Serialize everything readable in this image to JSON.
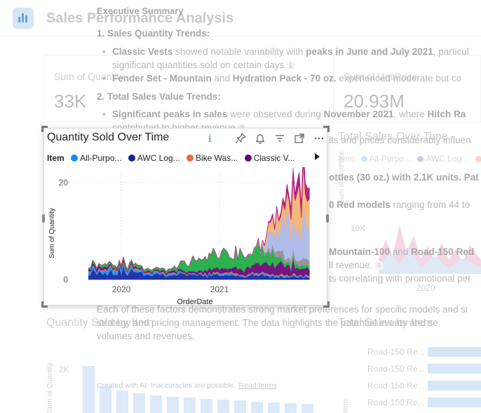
{
  "report": {
    "title": "Sales Performance Analysis",
    "cards": [
      {
        "label": "Sum of Quantity",
        "value": "33K"
      },
      {
        "label": "Sum of UnitPrice",
        "value": "20.93M"
      }
    ],
    "sections": {
      "total_sales_over_time": "Total Sales Over Time",
      "quantity_sold_by_item": "Quantity Sold by Item",
      "total_sales_by_item": "Total Sales by Item"
    },
    "bg_legend": {
      "label": "Item",
      "items": [
        "All-Purpo...",
        "AWC Log..."
      ]
    },
    "bg_axis": {
      "tick_10k": "10K",
      "tick_2020": "2020",
      "tick_2k": "2K",
      "ylabel_unitprice": "Sum of UnitPrice",
      "ylabel_quantity": "Sum of Quantity",
      "ylabel_item": "Item"
    },
    "hbar_labels": [
      "Road-150 Re...",
      "Road-150 Re...",
      "Road-150 Re...",
      "Road-150 Re..."
    ]
  },
  "summary": {
    "heading": "Executive Summary",
    "s1_title": "1. Sales Quantity Trends:",
    "s1_b1_bold1": "Classic Vests",
    "s1_b1_mid": " showed notable variability with ",
    "s1_b1_bold2": "peaks in June and July 2021",
    "s1_b1_end": ", particul",
    "s1_b1_cont": "significant quantities sold on certain days",
    "s1_b2_bold1": "Fender Set - Mountain",
    "s1_b2_mid": " and ",
    "s1_b2_bold2": "Hydration Pack - 70 oz.",
    "s1_b2_end": " experienced moderate but co",
    "s2_title": "2. Total Sales Value Trends:",
    "s2_b1_bold1": "Significant peaks in sales",
    "s2_b1_mid": " were observed during ",
    "s2_b1_bold2": "November 2021",
    "s2_b1_end": ", where ",
    "s2_b1_bold3": "Hitch Ra",
    "s2_b1_cont": "contributed to higher revenue",
    "r1_frag": "its and prices considerably influen",
    "r2_frag": "ottles (30 oz.) with 2.1K units. Pat",
    "r3_bold": "0 Red models",
    "r3_frag": " ranging from 44 to",
    "r4_bold1": "Mountain-100",
    "r4_mid": " and ",
    "r4_bold2": "Road-150 Red",
    "r5_frag": "ll revenue.",
    "r6_frag": "ts correlating with promotional per",
    "p1": "Each of these factors demonstrates strong market preferences for specific models and si",
    "p2": "strategy and pricing management. The data highlights the potential events and se",
    "p3": "volumes and revenues.",
    "cite1": "1",
    "cite2": "2",
    "cite5": "5",
    "footnote": "Created with AI. Inaccuracies are possible.",
    "footnote_link": "Read terms"
  },
  "visual": {
    "title": "Quantity Sold Over Time",
    "info_icon": "i",
    "legend_label": "Item",
    "icons": [
      "pin-icon",
      "bell-icon",
      "filter-icon",
      "focus-mode-icon",
      "more-options-icon"
    ]
  },
  "colors": {
    "all_purpose": "#118DFF",
    "awc_logo": "#12239E",
    "bike_wash": "#E66C37",
    "classic_vest": "#6B007B",
    "green": "#1AAB40",
    "orange_light": "#F5B26F",
    "lavender": "#A9B6E8",
    "gray": "#8E8E8E",
    "magenta": "#B0107A"
  },
  "chart_data": {
    "type": "area",
    "title": "Quantity Sold Over Time",
    "xlabel": "OrderDate",
    "ylabel": "Sum of Quantity",
    "x_ticks": [
      "2020",
      "2021"
    ],
    "y_ticks": [
      0,
      20
    ],
    "ylim": [
      0,
      22
    ],
    "grid": true,
    "stacked": true,
    "legend_title": "Item",
    "legend_position": "top",
    "legend_visible": [
      "All-Purpo...",
      "AWC Log...",
      "Bike Was...",
      "Classic V..."
    ],
    "x_range": [
      "2019-07",
      "2022-01"
    ],
    "series": [
      {
        "name": "AWC Log...",
        "color": "#12239E",
        "points": [
          [
            "2019-07",
            2
          ],
          [
            "2019-10",
            1.5
          ],
          [
            "2020-01",
            1.8
          ],
          [
            "2020-04",
            1.2
          ],
          [
            "2020-07",
            1.0
          ],
          [
            "2020-10",
            0.8
          ],
          [
            "2021-01",
            0.8
          ],
          [
            "2021-04",
            0.8
          ],
          [
            "2021-06",
            0.8
          ],
          [
            "2021-09",
            0.5
          ],
          [
            "2022-01",
            0.5
          ]
        ]
      },
      {
        "name": "All-Purpo...",
        "color": "#118DFF",
        "points": [
          [
            "2019-07",
            0.5
          ],
          [
            "2019-10",
            0.6
          ],
          [
            "2020-01",
            0.7
          ],
          [
            "2020-04",
            0.4
          ],
          [
            "2020-07",
            0.3
          ],
          [
            "2020-10",
            0.2
          ],
          [
            "2021-01",
            0.3
          ],
          [
            "2021-04",
            0.3
          ],
          [
            "2021-06",
            0.3
          ],
          [
            "2021-09",
            0.3
          ],
          [
            "2022-01",
            0.3
          ]
        ]
      },
      {
        "name": "Bike Was...",
        "color": "#E66C37",
        "points": [
          [
            "2019-07",
            0.2
          ],
          [
            "2019-10",
            0.2
          ],
          [
            "2020-01",
            0.3
          ],
          [
            "2020-04",
            0.2
          ],
          [
            "2020-07",
            0.2
          ],
          [
            "2020-10",
            0.1
          ],
          [
            "2021-01",
            0.2
          ],
          [
            "2021-04",
            0.2
          ],
          [
            "2021-06",
            0.2
          ],
          [
            "2021-09",
            0.2
          ],
          [
            "2022-01",
            0.2
          ]
        ]
      },
      {
        "name": "Classic V...",
        "color": "#6B007B",
        "points": [
          [
            "2019-07",
            0.3
          ],
          [
            "2019-10",
            0.4
          ],
          [
            "2020-01",
            0.3
          ],
          [
            "2020-04",
            0.2
          ],
          [
            "2020-07",
            0.3
          ],
          [
            "2020-10",
            0.3
          ],
          [
            "2021-01",
            0.8
          ],
          [
            "2021-04",
            1.0
          ],
          [
            "2021-06",
            1.6
          ],
          [
            "2021-09",
            2.0
          ],
          [
            "2022-01",
            2.0
          ]
        ]
      },
      {
        "color": "#1AAB40",
        "points": [
          [
            "2019-07",
            0.3
          ],
          [
            "2019-10",
            0.4
          ],
          [
            "2020-01",
            0.5
          ],
          [
            "2020-04",
            0.4
          ],
          [
            "2020-07",
            0.5
          ],
          [
            "2020-10",
            2.5
          ],
          [
            "2021-01",
            2.8
          ],
          [
            "2021-04",
            3.2
          ],
          [
            "2021-06",
            3.0
          ],
          [
            "2021-09",
            0.6
          ],
          [
            "2022-01",
            0.5
          ]
        ]
      },
      {
        "color": "#8E8E8E",
        "points": [
          [
            "2019-07",
            0
          ],
          [
            "2019-10",
            0
          ],
          [
            "2020-01",
            0
          ],
          [
            "2020-04",
            0
          ],
          [
            "2020-07",
            0
          ],
          [
            "2020-10",
            0
          ],
          [
            "2021-01",
            0
          ],
          [
            "2021-04",
            0
          ],
          [
            "2021-06",
            0.5
          ],
          [
            "2021-09",
            1.5
          ],
          [
            "2022-01",
            1.2
          ]
        ]
      },
      {
        "color": "#A9B6E8",
        "points": [
          [
            "2019-07",
            0
          ],
          [
            "2019-10",
            0
          ],
          [
            "2020-01",
            0
          ],
          [
            "2020-04",
            0
          ],
          [
            "2020-07",
            0
          ],
          [
            "2020-10",
            0
          ],
          [
            "2021-01",
            0
          ],
          [
            "2021-04",
            0
          ],
          [
            "2021-06",
            0
          ],
          [
            "2021-09",
            6.5
          ],
          [
            "2021-12",
            8.0
          ],
          [
            "2022-01",
            7.0
          ]
        ]
      },
      {
        "color": "#F5B26F",
        "points": [
          [
            "2019-07",
            0
          ],
          [
            "2019-10",
            0
          ],
          [
            "2020-01",
            0
          ],
          [
            "2020-04",
            0
          ],
          [
            "2020-07",
            0
          ],
          [
            "2020-10",
            0
          ],
          [
            "2021-01",
            0
          ],
          [
            "2021-04",
            0
          ],
          [
            "2021-06",
            0
          ],
          [
            "2021-09",
            4.5
          ],
          [
            "2021-11",
            7.0
          ],
          [
            "2021-12",
            7.5
          ],
          [
            "2022-01",
            5.0
          ]
        ]
      },
      {
        "color": "#B0107A",
        "points": [
          [
            "2019-07",
            0
          ],
          [
            "2019-10",
            0
          ],
          [
            "2020-01",
            0
          ],
          [
            "2020-04",
            0
          ],
          [
            "2020-07",
            0
          ],
          [
            "2020-10",
            0
          ],
          [
            "2021-01",
            0
          ],
          [
            "2021-04",
            0
          ],
          [
            "2021-06",
            0
          ],
          [
            "2021-09",
            1.0
          ],
          [
            "2021-11",
            2.5
          ],
          [
            "2021-12",
            3.0
          ],
          [
            "2022-01",
            1.5
          ]
        ]
      }
    ]
  }
}
